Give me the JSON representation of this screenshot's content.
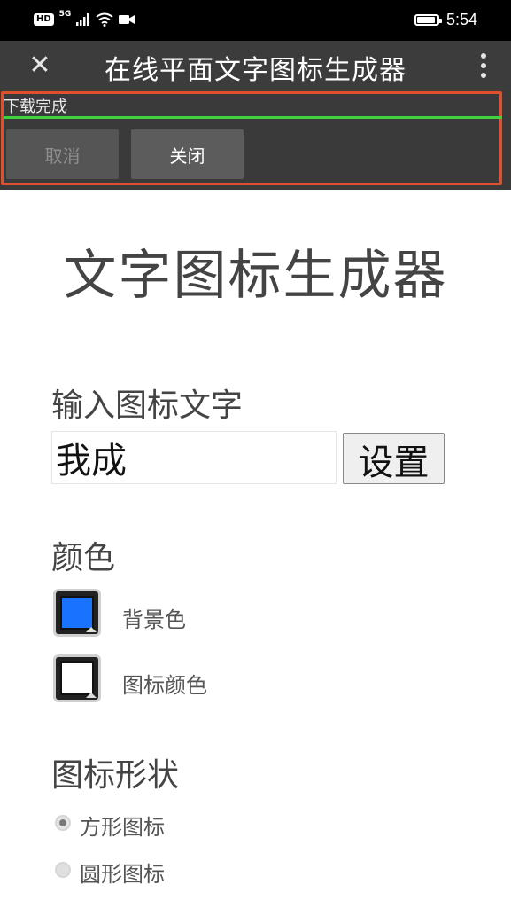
{
  "status_bar": {
    "hd_badge": "HD",
    "network": "5G",
    "time": "5:54",
    "battery_level": 0.9,
    "icons": [
      "hd-icon",
      "signal-icon",
      "wifi-icon",
      "video-icon",
      "battery-icon"
    ]
  },
  "toolbar": {
    "title": "在线平面文字图标生成器",
    "close_glyph": "✕"
  },
  "download": {
    "status": "下载完成",
    "progress": 1.0,
    "cancel_label": "取消",
    "close_label": "关闭",
    "progress_color": "#3fcf3f",
    "highlight_color": "#e0502f"
  },
  "page": {
    "heading": "文字图标生成器",
    "input_label": "输入图标文字",
    "input_value": "我成",
    "set_button": "设置",
    "color_label": "颜色",
    "colors": [
      {
        "label": "背景色",
        "value": "#1a73ff"
      },
      {
        "label": "图标颜色",
        "value": "#ffffff"
      }
    ],
    "shape_label": "图标形状",
    "shapes": [
      {
        "label": "方形图标",
        "checked": true
      },
      {
        "label": "圆形图标",
        "checked": false
      }
    ]
  }
}
